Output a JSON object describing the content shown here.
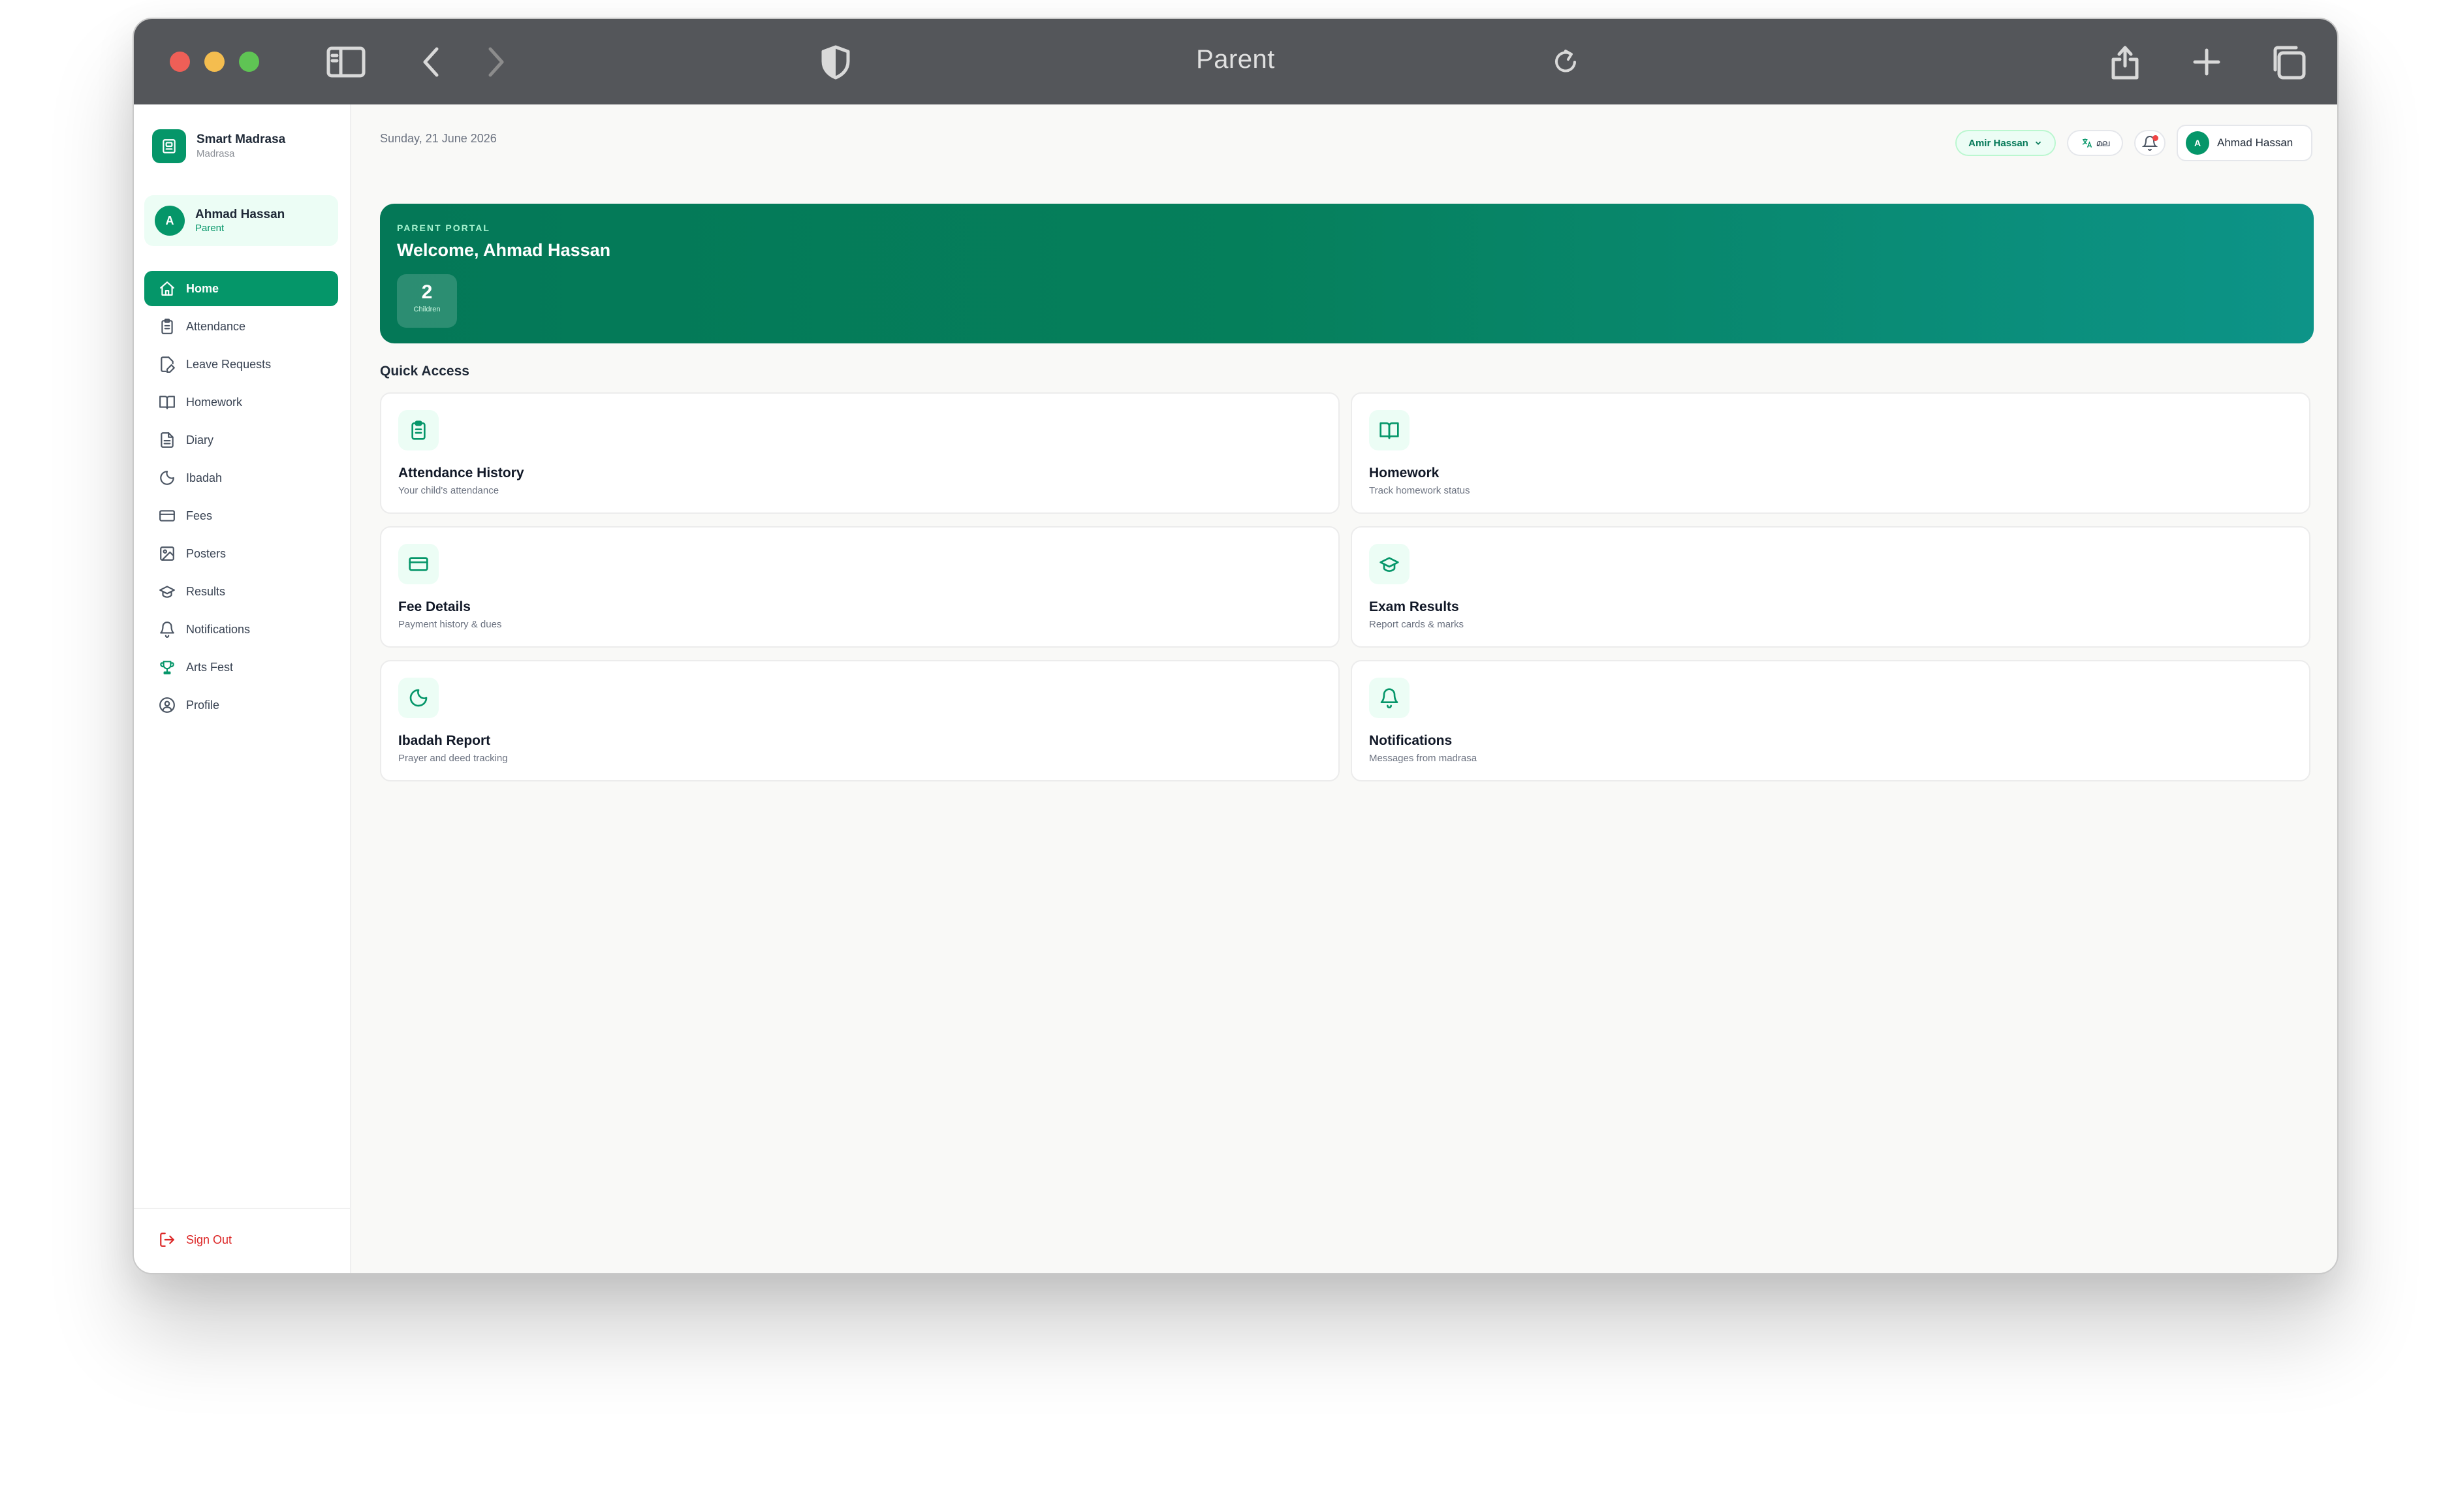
{
  "browser": {
    "tab_title": "Parent"
  },
  "sidebar": {
    "brand_name": "Smart Madrasa",
    "brand_subtitle": "Madrasa",
    "user": {
      "initial": "A",
      "name": "Ahmad Hassan",
      "role": "Parent"
    },
    "items": [
      {
        "label": "Home",
        "icon": "home-icon",
        "active": true
      },
      {
        "label": "Attendance",
        "icon": "clipboard-icon"
      },
      {
        "label": "Leave Requests",
        "icon": "file-edit-icon"
      },
      {
        "label": "Homework",
        "icon": "book-open-icon"
      },
      {
        "label": "Diary",
        "icon": "file-text-icon"
      },
      {
        "label": "Ibadah",
        "icon": "moon-icon"
      },
      {
        "label": "Fees",
        "icon": "credit-card-icon"
      },
      {
        "label": "Posters",
        "icon": "image-icon"
      },
      {
        "label": "Results",
        "icon": "graduation-cap-icon"
      },
      {
        "label": "Notifications",
        "icon": "bell-icon"
      },
      {
        "label": "Arts Fest",
        "icon": "trophy-icon"
      },
      {
        "label": "Profile",
        "icon": "user-circle-icon"
      }
    ],
    "sign_out": "Sign Out"
  },
  "header": {
    "date": "Sunday, 21 June 2026",
    "child_selector": "Amir Hassan",
    "language_label": "മല",
    "user": {
      "initial": "A",
      "name": "Ahmad Hassan"
    }
  },
  "hero": {
    "tag": "PARENT PORTAL",
    "title": "Welcome, Ahmad Hassan",
    "stat_value": "2",
    "stat_label": "Children"
  },
  "quick_access": {
    "title": "Quick Access",
    "cards": [
      {
        "title": "Attendance History",
        "subtitle": "Your child's attendance",
        "icon": "clipboard-icon"
      },
      {
        "title": "Homework",
        "subtitle": "Track homework status",
        "icon": "book-open-icon"
      },
      {
        "title": "Fee Details",
        "subtitle": "Payment history & dues",
        "icon": "credit-card-icon"
      },
      {
        "title": "Exam Results",
        "subtitle": "Report cards & marks",
        "icon": "graduation-cap-icon"
      },
      {
        "title": "Ibadah Report",
        "subtitle": "Prayer and deed tracking",
        "icon": "moon-icon"
      },
      {
        "title": "Notifications",
        "subtitle": "Messages from madrasa",
        "icon": "bell-icon"
      }
    ]
  },
  "colors": {
    "accent": "#059669",
    "danger": "#dc2626",
    "titlebar": "#54565a"
  }
}
